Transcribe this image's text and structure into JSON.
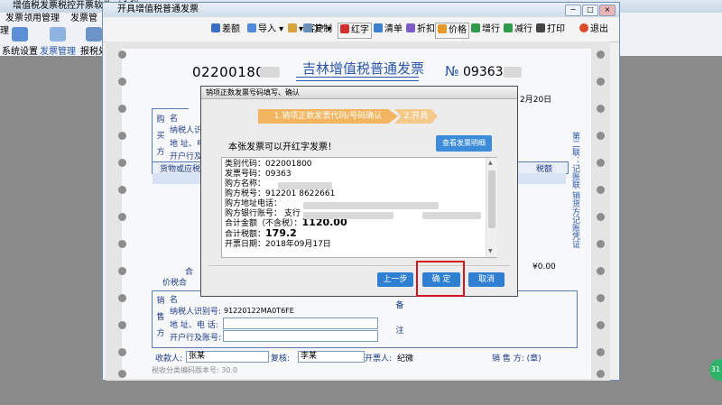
{
  "bg_app": {
    "title": "增值税发票税控开票软件（金税",
    "menu": [
      "发票领用管理",
      "发票管理"
    ],
    "toolbar": [
      "系统设置",
      "发票管理",
      "报税处"
    ],
    "status_badge": "31"
  },
  "window": {
    "title": "开具增值税普通发票",
    "controls": [
      "−",
      "□",
      "×"
    ],
    "toolbar": [
      {
        "label": "差额",
        "icon": "doc-icon"
      },
      {
        "label": "导入 ▾",
        "icon": "import-icon"
      },
      {
        "label": "▾ 客户 ▾",
        "icon": "customer-icon"
      },
      {
        "label": "复制",
        "icon": "copy-icon"
      },
      {
        "label": "红字",
        "icon": "red-invoice-icon"
      },
      {
        "label": "清单",
        "icon": "list-icon"
      },
      {
        "label": "折扣",
        "icon": "discount-icon"
      },
      {
        "label": "价格",
        "icon": "price-icon"
      },
      {
        "label": "增行",
        "icon": "add-row-icon"
      },
      {
        "label": "减行",
        "icon": "remove-row-icon"
      },
      {
        "label": "打印",
        "icon": "print-icon"
      },
      {
        "label": "退出",
        "icon": "exit-icon"
      }
    ]
  },
  "invoice": {
    "code": "022001800",
    "title": "吉林增值税普通发票",
    "no_label": "№",
    "number": "09363",
    "date_suffix": "2月20日",
    "buyer_label": [
      "购",
      "买",
      "方"
    ],
    "buyer_fields": [
      "名",
      "纳税人识别",
      "地 址、电",
      "开户行及账"
    ],
    "goods_header": "货物或应税",
    "tax_header": "税额",
    "total_label": "合",
    "total_tax": "¥0.00",
    "total_incl_label": "价税合",
    "side_text": "第二联：记账联 销货方记账凭证",
    "seller_label": [
      "销",
      "售",
      "方"
    ],
    "seller_fields": [
      "名",
      "纳税人识别号:",
      "地 址、电 话:",
      "开户行及账号:"
    ],
    "seller_tax_id": "91220122MA0T6FE",
    "remark_label": [
      "备",
      "注"
    ],
    "payee_label": "收款人:",
    "payee": "张某",
    "reviewer_label": "复核:",
    "reviewer": "李某",
    "issuer_label": "开票人:",
    "issuer": "纪微",
    "seller_stamp_label": "销 售 方: (章)",
    "footnote": "税收分类编码版本号: 30.0"
  },
  "dialog": {
    "title": "销项正数发票号码填写、确认",
    "step1": "1.销项正数发票代码/号码确认",
    "step2": "2.开具",
    "message": "本张发票可以开红字发票！",
    "view_detail_button": "查看发票明细",
    "info": [
      "类别代码：022001800",
      "发票号码：09363",
      "购方名称：",
      "购方税号：912201      8622661",
      "购方地址电话：",
      "购方银行账号：                                          支行",
      "合计金额（不含税）：",
      "合计税额：",
      "开票日期：2018年09月17日"
    ],
    "amount_excl_tax": "1120.00",
    "tax_amount": "179.2",
    "prev_button": "上一步",
    "confirm_button": "确 定",
    "cancel_button": "取消"
  }
}
